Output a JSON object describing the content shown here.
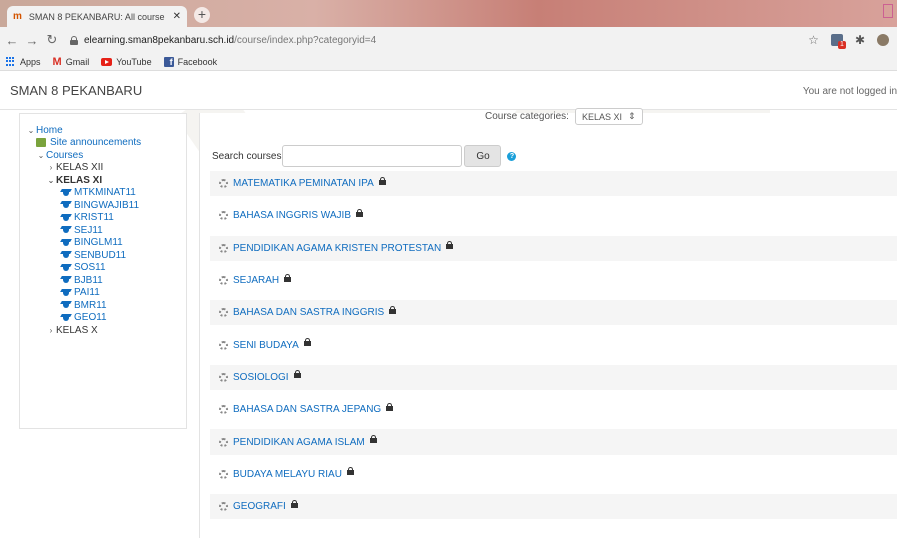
{
  "browser": {
    "tab_title": "SMAN 8 PEKANBARU: All course",
    "tab_favicon": "moodle-icon",
    "new_tab": "+",
    "url_host": "elearning.sman8pekanbaru.sch.id",
    "url_path": "/course/index.php?categoryid=4",
    "bookmarks": [
      {
        "label": "Apps",
        "icon": "apps-icon"
      },
      {
        "label": "Gmail",
        "icon": "gmail-icon"
      },
      {
        "label": "YouTube",
        "icon": "youtube-icon"
      },
      {
        "label": "Facebook",
        "icon": "facebook-icon"
      }
    ]
  },
  "header": {
    "site_name": "SMAN 8 PEKANBARU",
    "login_info": "You are not logged in"
  },
  "sidebar": {
    "home": "Home",
    "site_announcements": "Site announcements",
    "courses": "Courses",
    "kelas_xii": "KELAS XII",
    "kelas_xi": "KELAS XI",
    "kelas_xi_courses": [
      "MTKMINAT11",
      "BINGWAJIB11",
      "KRIST11",
      "SEJ11",
      "BINGLM11",
      "SENBUD11",
      "SOS11",
      "BJB11",
      "PAI11",
      "BMR11",
      "GEO11"
    ],
    "kelas_x": "KELAS X"
  },
  "main": {
    "category_label": "Course categories:",
    "category_value": "KELAS XI",
    "search_label": "Search courses",
    "search_value": "",
    "go_label": "Go",
    "courses": [
      "MATEMATIKA PEMINATAN IPA",
      "BAHASA INGGRIS WAJIB",
      "PENDIDIKAN AGAMA KRISTEN PROTESTAN",
      "SEJARAH",
      "BAHASA DAN SASTRA INGGRIS",
      "SENI BUDAYA",
      "SOSIOLOGI",
      "BAHASA DAN SASTRA JEPANG",
      "PENDIDIKAN AGAMA ISLAM",
      "BUDAYA MELAYU RIAU",
      "GEOGRAFI"
    ]
  },
  "colors": {
    "link": "#0f6cbf",
    "row_alt": "#f5f5f5"
  }
}
